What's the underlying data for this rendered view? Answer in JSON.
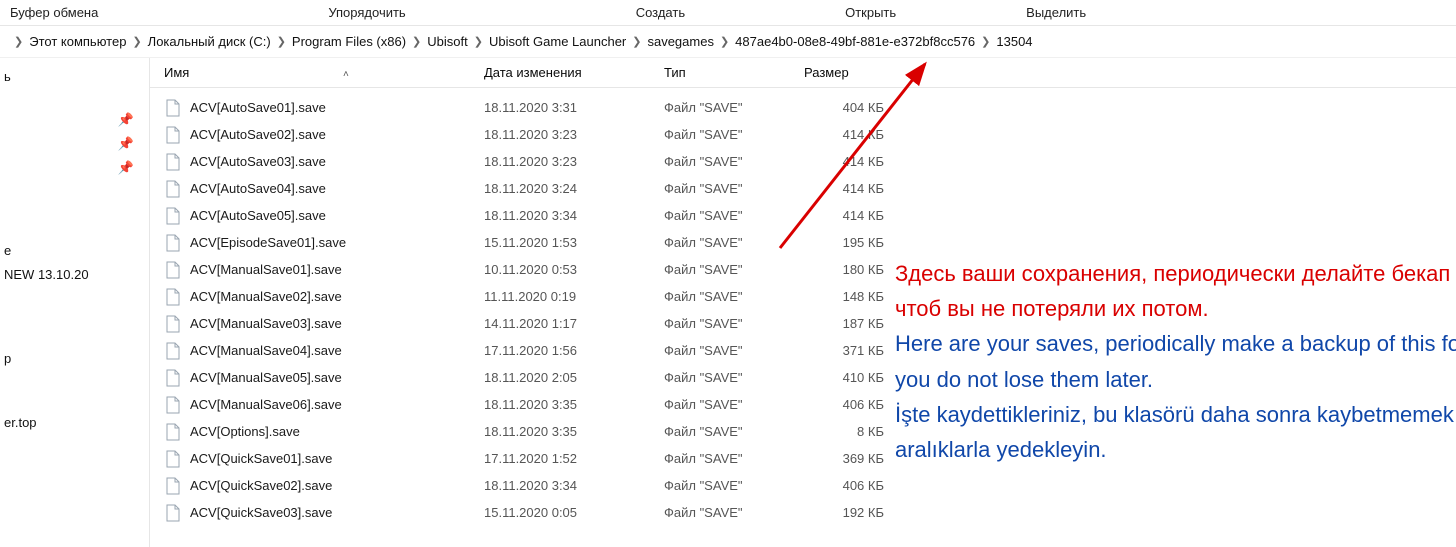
{
  "topmenu": [
    "Буфер обмена",
    "Упорядочить",
    "Создать",
    "Открыть",
    "Выделить"
  ],
  "breadcrumb": [
    "Этот компьютер",
    "Локальный диск (C:)",
    "Program Files (x86)",
    "Ubisoft",
    "Ubisoft Game Launcher",
    "savegames",
    "487ae4b0-08e8-49bf-881e-e372bf8cc576",
    "13504"
  ],
  "sidebar": {
    "new_folder": "NEW 13.10.20",
    "site": "er.top"
  },
  "columns": {
    "name": "Имя",
    "date": "Дата изменения",
    "type": "Тип",
    "size": "Размер"
  },
  "files": [
    {
      "name": "ACV[AutoSave01].save",
      "date": "18.11.2020 3:31",
      "type": "Файл \"SAVE\"",
      "size": "404 КБ"
    },
    {
      "name": "ACV[AutoSave02].save",
      "date": "18.11.2020 3:23",
      "type": "Файл \"SAVE\"",
      "size": "414 КБ"
    },
    {
      "name": "ACV[AutoSave03].save",
      "date": "18.11.2020 3:23",
      "type": "Файл \"SAVE\"",
      "size": "414 КБ"
    },
    {
      "name": "ACV[AutoSave04].save",
      "date": "18.11.2020 3:24",
      "type": "Файл \"SAVE\"",
      "size": "414 КБ"
    },
    {
      "name": "ACV[AutoSave05].save",
      "date": "18.11.2020 3:34",
      "type": "Файл \"SAVE\"",
      "size": "414 КБ"
    },
    {
      "name": "ACV[EpisodeSave01].save",
      "date": "15.11.2020 1:53",
      "type": "Файл \"SAVE\"",
      "size": "195 КБ"
    },
    {
      "name": "ACV[ManualSave01].save",
      "date": "10.11.2020 0:53",
      "type": "Файл \"SAVE\"",
      "size": "180 КБ"
    },
    {
      "name": "ACV[ManualSave02].save",
      "date": "11.11.2020 0:19",
      "type": "Файл \"SAVE\"",
      "size": "148 КБ"
    },
    {
      "name": "ACV[ManualSave03].save",
      "date": "14.11.2020 1:17",
      "type": "Файл \"SAVE\"",
      "size": "187 КБ"
    },
    {
      "name": "ACV[ManualSave04].save",
      "date": "17.11.2020 1:56",
      "type": "Файл \"SAVE\"",
      "size": "371 КБ"
    },
    {
      "name": "ACV[ManualSave05].save",
      "date": "18.11.2020 2:05",
      "type": "Файл \"SAVE\"",
      "size": "410 КБ"
    },
    {
      "name": "ACV[ManualSave06].save",
      "date": "18.11.2020 3:35",
      "type": "Файл \"SAVE\"",
      "size": "406 КБ"
    },
    {
      "name": "ACV[Options].save",
      "date": "18.11.2020 3:35",
      "type": "Файл \"SAVE\"",
      "size": "8 КБ"
    },
    {
      "name": "ACV[QuickSave01].save",
      "date": "17.11.2020 1:52",
      "type": "Файл \"SAVE\"",
      "size": "369 КБ"
    },
    {
      "name": "ACV[QuickSave02].save",
      "date": "18.11.2020 3:34",
      "type": "Файл \"SAVE\"",
      "size": "406 КБ"
    },
    {
      "name": "ACV[QuickSave03].save",
      "date": "15.11.2020 0:05",
      "type": "Файл \"SAVE\"",
      "size": "192 КБ"
    }
  ],
  "annotation": {
    "ru": "Здесь ваши сохранения, периодически делайте бекап этой папки чтоб вы не потеряли их потом.",
    "en": "Here are your saves, periodically make a backup of this folder so that you do not lose them later.",
    "tr": "İşte kaydettikleriniz, bu klasörü daha sonra kaybetmemek için düzenli aralıklarla yedekleyin."
  }
}
